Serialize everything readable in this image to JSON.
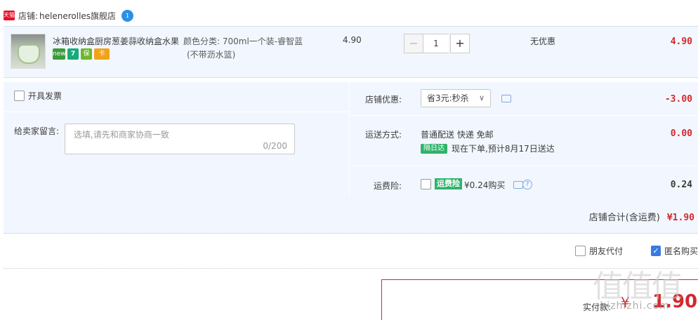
{
  "shop": {
    "badge": "天猫",
    "label": "店铺:",
    "name": "helenerolles旗舰店",
    "ww": "1"
  },
  "item": {
    "title": "冰箱收纳盒厨房葱姜蒜收纳盒水果",
    "services": [
      "new",
      "7",
      "保",
      "卡"
    ],
    "sku_label": "颜色分类: 700ml一个装-睿智蓝",
    "sku_value": "(不带沥水篮)",
    "unit_price": "4.90",
    "qty_minus": "−",
    "qty": "1",
    "qty_plus": "+",
    "promo": "无优惠",
    "total": "4.90"
  },
  "options": {
    "invoice_label": "开具发票",
    "memo_label": "给卖家留言:",
    "memo_placeholder": "选填,请先和商家协商一致",
    "memo_count": "0/200",
    "shop_discount_label": "店铺优惠:",
    "shop_discount_selected": "省3元:秒杀",
    "shop_discount_value": "-3.00",
    "shipping_label": "运送方式:",
    "shipping_method": "普通配送 快递 免邮",
    "next_day_tag": "隔日达",
    "delivery_note": "现在下单,预计8月17日送达",
    "shipping_value": "0.00",
    "insurance_label": "运费险:",
    "insurance_tag": "运费险",
    "insurance_price": "¥0.24购买",
    "insurance_value": "0.24",
    "subtotal_label": "店铺合计(含运费)",
    "subtotal_value": "¥1.90"
  },
  "footer": {
    "friend_pay_label": "朋友代付",
    "anon_label": "匿名购买",
    "pay_label": "实付款:",
    "pay_currency": "¥",
    "pay_value": "1.90"
  },
  "watermark": {
    "big": "值值值",
    "small": "zhizhizhi.com"
  },
  "colors": {
    "price_red": "#d4282d",
    "panel_bg": "#f2f7ff",
    "check_blue": "#3b7be0",
    "tag_green": "#2fb36b"
  }
}
